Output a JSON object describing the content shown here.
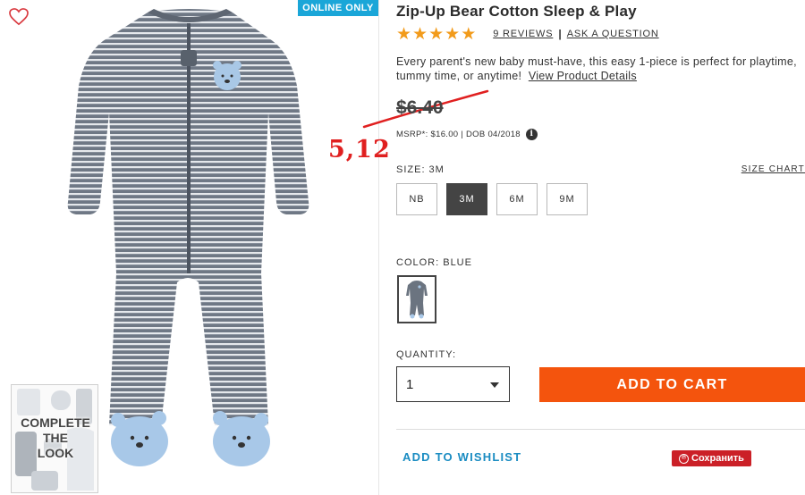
{
  "badge": {
    "online_only": "ONLINE ONLY"
  },
  "complete_look": {
    "label_line1": "COMPLETE",
    "label_line2": "THE",
    "label_line3": "LOOK"
  },
  "product": {
    "title": "Zip-Up Bear Cotton Sleep & Play",
    "rating": 5,
    "rating_max": 5,
    "reviews_link": "9 REVIEWS",
    "separator": "|",
    "ask_link": "ASK A QUESTION",
    "description": "Every parent's new baby must-have, this easy 1-piece is perfect for playtime, tummy time, or anytime!",
    "details_link": "View Product Details",
    "price": "$6.40",
    "msrp": "MSRP*: $16.00 | DOB 04/2018",
    "info_icon": "i",
    "handwritten_price": "5,12"
  },
  "size": {
    "label": "SIZE: 3M",
    "chart_link": "SIZE CHART",
    "options": [
      "NB",
      "3M",
      "6M",
      "9M"
    ],
    "selected": "3M"
  },
  "color": {
    "label": "COLOR: BLUE",
    "swatch_color": "#6b7480"
  },
  "quantity": {
    "label": "QUANTITY:",
    "value": "1"
  },
  "actions": {
    "add_to_cart": "ADD TO CART",
    "add_to_wishlist": "ADD TO WISHLIST",
    "pinterest_logo": "℗",
    "pinterest_save": "Сохранить"
  },
  "colors": {
    "accent_orange": "#f4540d",
    "badge_blue": "#1aa6d8",
    "wishlist_blue": "#1a8cc2",
    "star": "#f29b1b",
    "pin_red": "#cb2027"
  },
  "icons": {
    "heart": "heart-outline-icon",
    "info": "info-icon",
    "caret": "chevron-down-icon",
    "star": "star-icon"
  }
}
